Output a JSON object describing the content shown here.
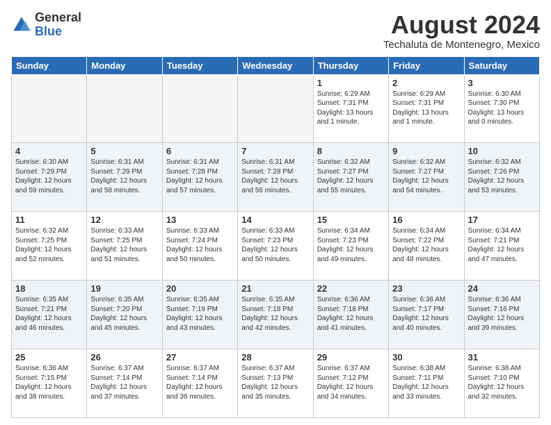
{
  "header": {
    "logo_general": "General",
    "logo_blue": "Blue",
    "main_title": "August 2024",
    "subtitle": "Techaluta de Montenegro, Mexico"
  },
  "calendar": {
    "days_of_week": [
      "Sunday",
      "Monday",
      "Tuesday",
      "Wednesday",
      "Thursday",
      "Friday",
      "Saturday"
    ],
    "weeks": [
      [
        {
          "day": "",
          "info": "",
          "empty": true
        },
        {
          "day": "",
          "info": "",
          "empty": true
        },
        {
          "day": "",
          "info": "",
          "empty": true
        },
        {
          "day": "",
          "info": "",
          "empty": true
        },
        {
          "day": "1",
          "info": "Sunrise: 6:29 AM\nSunset: 7:31 PM\nDaylight: 13 hours\nand 1 minute.",
          "empty": false
        },
        {
          "day": "2",
          "info": "Sunrise: 6:29 AM\nSunset: 7:31 PM\nDaylight: 13 hours\nand 1 minute.",
          "empty": false
        },
        {
          "day": "3",
          "info": "Sunrise: 6:30 AM\nSunset: 7:30 PM\nDaylight: 13 hours\nand 0 minutes.",
          "empty": false
        }
      ],
      [
        {
          "day": "4",
          "info": "Sunrise: 6:30 AM\nSunset: 7:29 PM\nDaylight: 12 hours\nand 59 minutes.",
          "empty": false
        },
        {
          "day": "5",
          "info": "Sunrise: 6:31 AM\nSunset: 7:29 PM\nDaylight: 12 hours\nand 58 minutes.",
          "empty": false
        },
        {
          "day": "6",
          "info": "Sunrise: 6:31 AM\nSunset: 7:28 PM\nDaylight: 12 hours\nand 57 minutes.",
          "empty": false
        },
        {
          "day": "7",
          "info": "Sunrise: 6:31 AM\nSunset: 7:28 PM\nDaylight: 12 hours\nand 56 minutes.",
          "empty": false
        },
        {
          "day": "8",
          "info": "Sunrise: 6:32 AM\nSunset: 7:27 PM\nDaylight: 12 hours\nand 55 minutes.",
          "empty": false
        },
        {
          "day": "9",
          "info": "Sunrise: 6:32 AM\nSunset: 7:27 PM\nDaylight: 12 hours\nand 54 minutes.",
          "empty": false
        },
        {
          "day": "10",
          "info": "Sunrise: 6:32 AM\nSunset: 7:26 PM\nDaylight: 12 hours\nand 53 minutes.",
          "empty": false
        }
      ],
      [
        {
          "day": "11",
          "info": "Sunrise: 6:32 AM\nSunset: 7:25 PM\nDaylight: 12 hours\nand 52 minutes.",
          "empty": false
        },
        {
          "day": "12",
          "info": "Sunrise: 6:33 AM\nSunset: 7:25 PM\nDaylight: 12 hours\nand 51 minutes.",
          "empty": false
        },
        {
          "day": "13",
          "info": "Sunrise: 6:33 AM\nSunset: 7:24 PM\nDaylight: 12 hours\nand 50 minutes.",
          "empty": false
        },
        {
          "day": "14",
          "info": "Sunrise: 6:33 AM\nSunset: 7:23 PM\nDaylight: 12 hours\nand 50 minutes.",
          "empty": false
        },
        {
          "day": "15",
          "info": "Sunrise: 6:34 AM\nSunset: 7:23 PM\nDaylight: 12 hours\nand 49 minutes.",
          "empty": false
        },
        {
          "day": "16",
          "info": "Sunrise: 6:34 AM\nSunset: 7:22 PM\nDaylight: 12 hours\nand 48 minutes.",
          "empty": false
        },
        {
          "day": "17",
          "info": "Sunrise: 6:34 AM\nSunset: 7:21 PM\nDaylight: 12 hours\nand 47 minutes.",
          "empty": false
        }
      ],
      [
        {
          "day": "18",
          "info": "Sunrise: 6:35 AM\nSunset: 7:21 PM\nDaylight: 12 hours\nand 46 minutes.",
          "empty": false
        },
        {
          "day": "19",
          "info": "Sunrise: 6:35 AM\nSunset: 7:20 PM\nDaylight: 12 hours\nand 45 minutes.",
          "empty": false
        },
        {
          "day": "20",
          "info": "Sunrise: 6:35 AM\nSunset: 7:19 PM\nDaylight: 12 hours\nand 43 minutes.",
          "empty": false
        },
        {
          "day": "21",
          "info": "Sunrise: 6:35 AM\nSunset: 7:18 PM\nDaylight: 12 hours\nand 42 minutes.",
          "empty": false
        },
        {
          "day": "22",
          "info": "Sunrise: 6:36 AM\nSunset: 7:18 PM\nDaylight: 12 hours\nand 41 minutes.",
          "empty": false
        },
        {
          "day": "23",
          "info": "Sunrise: 6:36 AM\nSunset: 7:17 PM\nDaylight: 12 hours\nand 40 minutes.",
          "empty": false
        },
        {
          "day": "24",
          "info": "Sunrise: 6:36 AM\nSunset: 7:16 PM\nDaylight: 12 hours\nand 39 minutes.",
          "empty": false
        }
      ],
      [
        {
          "day": "25",
          "info": "Sunrise: 6:36 AM\nSunset: 7:15 PM\nDaylight: 12 hours\nand 38 minutes.",
          "empty": false
        },
        {
          "day": "26",
          "info": "Sunrise: 6:37 AM\nSunset: 7:14 PM\nDaylight: 12 hours\nand 37 minutes.",
          "empty": false
        },
        {
          "day": "27",
          "info": "Sunrise: 6:37 AM\nSunset: 7:14 PM\nDaylight: 12 hours\nand 36 minutes.",
          "empty": false
        },
        {
          "day": "28",
          "info": "Sunrise: 6:37 AM\nSunset: 7:13 PM\nDaylight: 12 hours\nand 35 minutes.",
          "empty": false
        },
        {
          "day": "29",
          "info": "Sunrise: 6:37 AM\nSunset: 7:12 PM\nDaylight: 12 hours\nand 34 minutes.",
          "empty": false
        },
        {
          "day": "30",
          "info": "Sunrise: 6:38 AM\nSunset: 7:11 PM\nDaylight: 12 hours\nand 33 minutes.",
          "empty": false
        },
        {
          "day": "31",
          "info": "Sunrise: 6:38 AM\nSunset: 7:10 PM\nDaylight: 12 hours\nand 32 minutes.",
          "empty": false
        }
      ]
    ]
  }
}
